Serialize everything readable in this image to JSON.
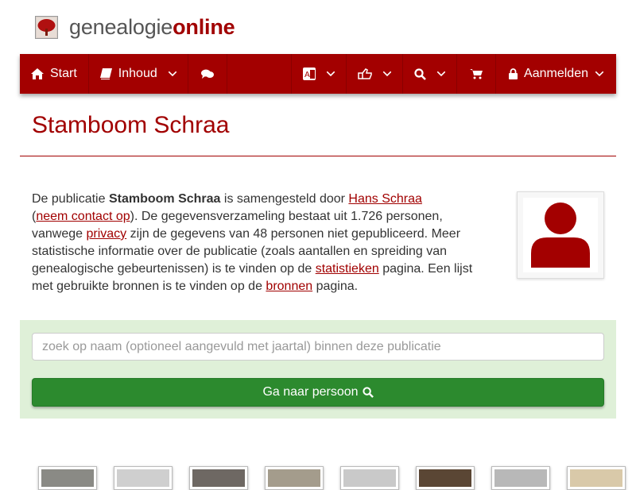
{
  "site": {
    "brand_part1": "genealogie",
    "brand_part2": "online"
  },
  "nav": {
    "start": "Start",
    "inhoud": "Inhoud",
    "aanmelden": "Aanmelden"
  },
  "page": {
    "title": "Stamboom Schraa"
  },
  "intro": {
    "t1": "De publicatie ",
    "pub_name": "Stamboom Schraa",
    "t2": " is samengesteld door ",
    "author_link": "Hans Schraa",
    "t3": " (",
    "contact_link": "neem contact op",
    "t4": "). De gegevensverzameling bestaat uit 1.726 personen, vanwege ",
    "privacy_link": "privacy",
    "t5": " zijn de gegevens van 48 personen niet gepubliceerd. Meer statistische informatie over de publicatie (zoals aantallen en spreiding van genealogische gebeurtenissen) is te vinden op de ",
    "stats_link": "statistieken",
    "t6": " pagina. Een lijst met gebruikte bronnen is te vinden op de ",
    "sources_link": "bronnen",
    "t7": " pagina."
  },
  "search": {
    "placeholder": "zoek op naam (optioneel aangevuld met jaartal) binnen deze publicatie",
    "value": "",
    "button_label": "Ga naar persoon"
  },
  "colors": {
    "brand_red": "#a30000",
    "search_bg": "#dff0d8",
    "button_green": "#2c8a2e"
  },
  "thumbnails": [
    {
      "icon": "photo-thumbnail",
      "tone": "#8a8a85"
    },
    {
      "icon": "document-thumbnail",
      "tone": "#cfcfcf"
    },
    {
      "icon": "photo-thumbnail",
      "tone": "#6e6863"
    },
    {
      "icon": "photo-thumbnail",
      "tone": "#a49c8c"
    },
    {
      "icon": "document-thumbnail",
      "tone": "#c9c9c9"
    },
    {
      "icon": "photo-thumbnail",
      "tone": "#5a4634"
    },
    {
      "icon": "document-thumbnail",
      "tone": "#b8b8b8"
    },
    {
      "icon": "photo-thumbnail",
      "tone": "#d9c9a9"
    }
  ]
}
